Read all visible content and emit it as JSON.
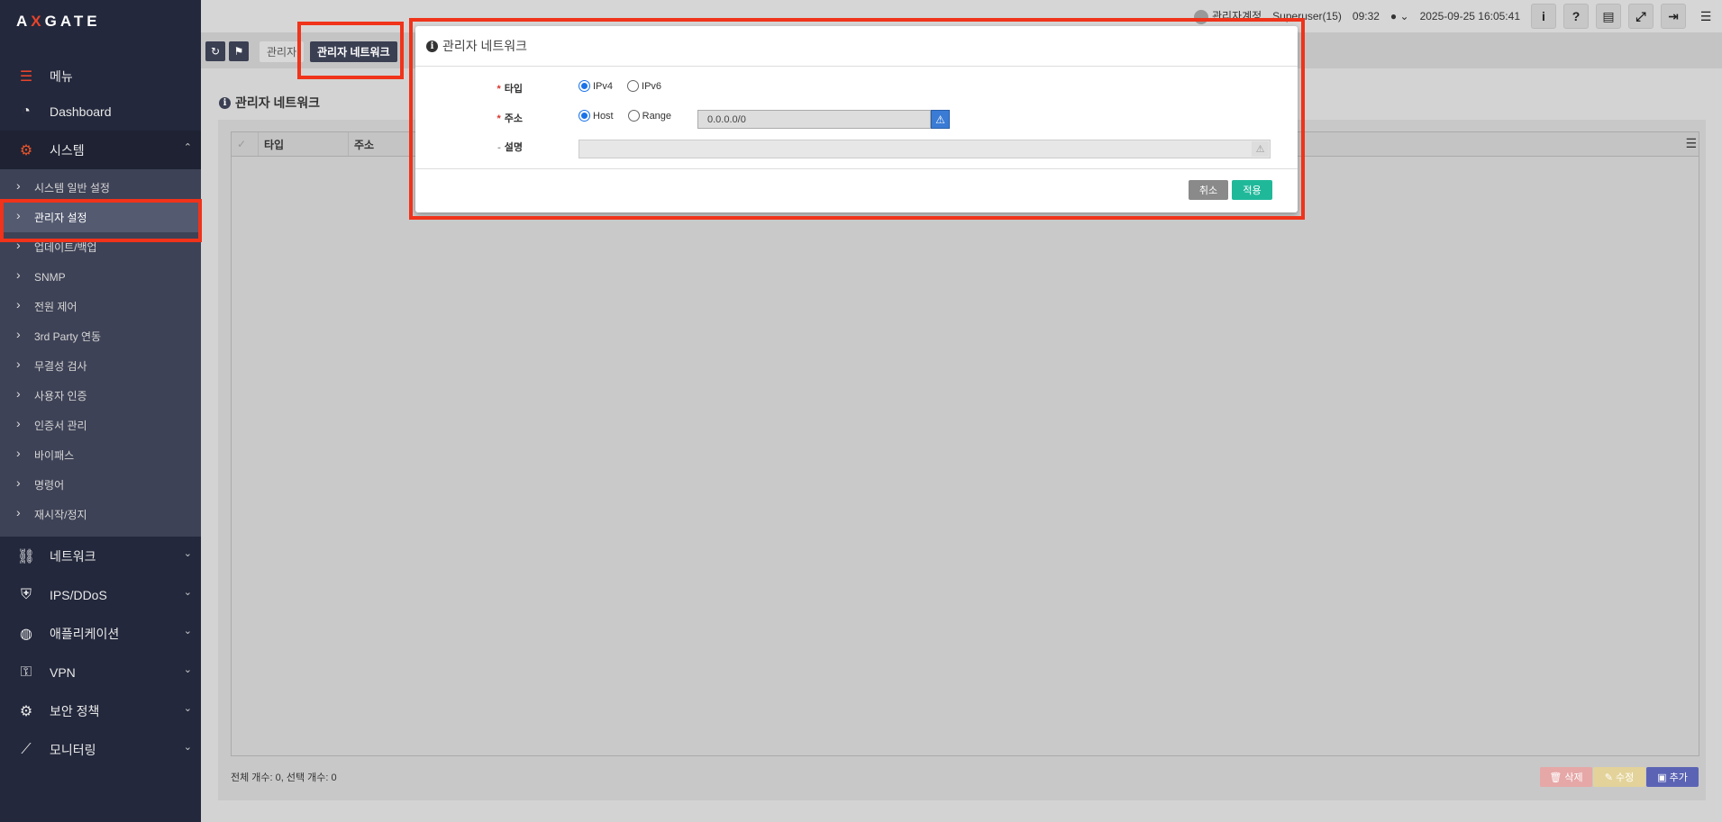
{
  "app": {
    "logo_a": "A",
    "logo_x": "X",
    "logo_rest": "GATE"
  },
  "sidebar": {
    "menu_header": "메뉴",
    "dashboard": "Dashboard",
    "system": "시스템",
    "system_items": [
      "시스템 일반 설정",
      "관리자 설정",
      "업데이트/백업",
      "SNMP",
      "전원 제어",
      "3rd Party 연동",
      "무결성 검사",
      "사용자 인증",
      "인증서 관리",
      "바이패스",
      "명령어",
      "재시작/정지"
    ],
    "network": "네트워크",
    "ips": "IPS/DDoS",
    "application": "애플리케이션",
    "vpn": "VPN",
    "security_policy": "보안 정책",
    "monitoring": "모니터링"
  },
  "topbar": {
    "account": "관리자계정",
    "user": "Superuser(15)",
    "time": "09:32",
    "datetime": "2025-09-25 16:05:41"
  },
  "tabs": {
    "tab1": "관리자",
    "tab2": "관리자 네트워크"
  },
  "content": {
    "title": "관리자 네트워크",
    "columns": [
      "타입",
      "주소"
    ],
    "footer": "전체 개수: 0, 선택 개수: 0",
    "btn_delete": "삭제",
    "btn_edit": "수정",
    "btn_add": "추가"
  },
  "modal": {
    "title": "관리자 네트워크",
    "type_label": "타입",
    "type_options": [
      "IPv4",
      "IPv6"
    ],
    "addr_label": "주소",
    "addr_options": [
      "Host",
      "Range"
    ],
    "addr_value": "0.0.0.0/0",
    "desc_label": "설명",
    "cancel": "취소",
    "apply": "적용"
  },
  "colors": {
    "sidebar_bg": "#23283c",
    "accent_red": "#e8442b",
    "apply_teal": "#1fb99a",
    "add_blue": "#5b64b4"
  }
}
